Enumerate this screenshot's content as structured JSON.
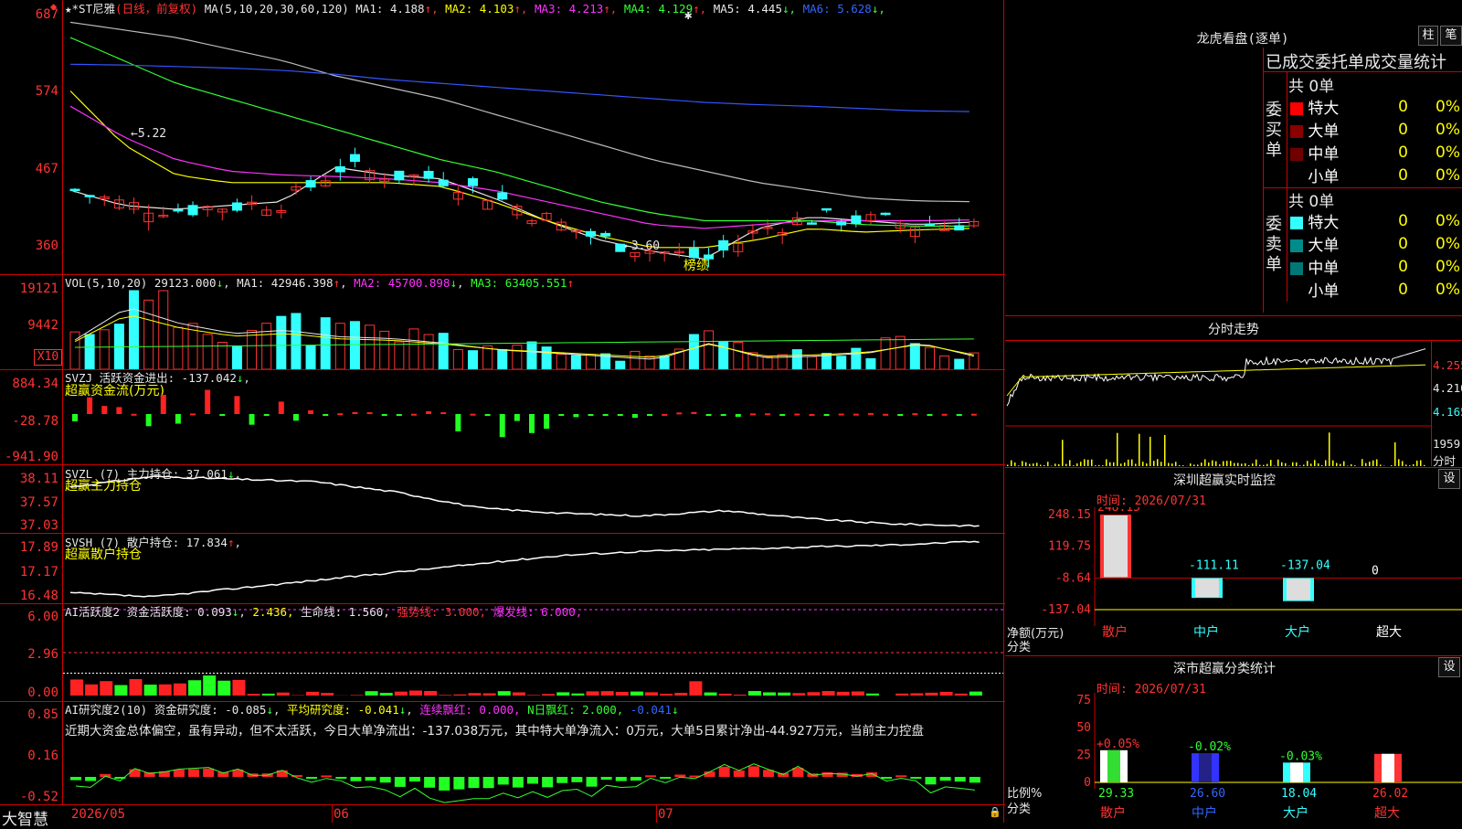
{
  "app": {
    "logo": "大智慧"
  },
  "k_header": {
    "stock": "★*ST尼雅",
    "mode": "(日线，前复权)",
    "ma_label": "MA(5,10,20,30,60,120)",
    "ma": [
      {
        "name": "MA1:",
        "value": "4.188",
        "arrow": "↑",
        "color": "#e8e8e8"
      },
      {
        "name": "MA2:",
        "value": "4.103",
        "arrow": "↑",
        "color": "#ffff00"
      },
      {
        "name": "MA3:",
        "value": "4.213",
        "arrow": "↑",
        "color": "#ff33ff"
      },
      {
        "name": "MA4:",
        "value": "4.129",
        "arrow": "↑",
        "color": "#33ff33"
      },
      {
        "name": "MA5:",
        "value": "4.445",
        "arrow": "↓",
        "color": "#e8e8e8"
      },
      {
        "name": "MA6:",
        "value": "5.628",
        "arrow": "↓",
        "color": "#3366ff"
      }
    ],
    "high_mark": "←5.22",
    "low_mark": "←3.60",
    "tag": "榜绩"
  },
  "k_axis": [
    "687",
    "574",
    "467",
    "360"
  ],
  "vol_header": {
    "label": "VOL(5,10,20)",
    "value": "29123.000",
    "arrow": "↓",
    "ma1": "MA1: 42946.398",
    "ma1_arrow": "↑",
    "ma2": "MA2: 45700.898",
    "ma2_arrow": "↓",
    "ma3": "MA3: 63405.551",
    "ma3_arrow": "↑"
  },
  "vol_axis": [
    "19121",
    "9442",
    "X10"
  ],
  "zj_header": {
    "label": "SVZJ  活跃资金进出: -137.042",
    "arrow": "↓",
    "sub": "超赢资金流(万元)"
  },
  "zj_axis": [
    "884.34",
    "-28.78",
    "-941.90"
  ],
  "zl_header": {
    "label": "SVZL (7) 主力持仓: 37.061",
    "arrow": "↓",
    "sub": "超赢主力持仓"
  },
  "zl_axis": [
    "38.11",
    "37.57",
    "37.03"
  ],
  "sh_header": {
    "label": "SVSH (7) 散户持仓: 17.834",
    "arrow": "↑",
    "sub": "超赢散户持仓"
  },
  "sh_axis": [
    "17.89",
    "17.17",
    "16.48"
  ],
  "ai_header": {
    "p1": "AI活跃度2 资金活跃度: 0.093",
    "a1": "↓",
    "p2": "2.436,",
    "p3": "生命线: 1.560,",
    "p4": "强势线: 3.000,",
    "p5": "爆发线: 6.000,"
  },
  "ai_axis": [
    "6.00",
    "2.96",
    "0.00"
  ],
  "yj_header": {
    "p1": "AI研究度2(10) 资金研究度: -0.085",
    "a1": "↓",
    "p2": "平均研究度: -0.041",
    "a2": "↓",
    "p3": "连续飘红: 0.000,",
    "p4": "N日飘红: 2.000,",
    "p5": "-0.041",
    "a5": "↓"
  },
  "yj_text": "近期大资金总体偏空，虽有异动，但不太活跃，今日大单净流出：-137.038万元，其中特大单净流入：0万元，大单5日累计净出-44.927万元，当前主力控盘",
  "yj_axis": [
    "0.85",
    "0.16",
    "-0.52"
  ],
  "x_axis": [
    "2026/05",
    "06",
    "07"
  ],
  "lhb": {
    "title": "龙虎看盘(逐单)",
    "tabs": [
      "柱",
      "笔"
    ],
    "subtitle": "已成交委托单成交量统计",
    "buy_label": "委买单",
    "sell_label": "委卖单",
    "buy_total": "共 0单",
    "sell_total": "共 0单",
    "buy": [
      {
        "name": "特大",
        "n": "0",
        "pct": "0%",
        "color": "#ff0000"
      },
      {
        "name": "大单",
        "n": "0",
        "pct": "0%",
        "color": "#8b0000"
      },
      {
        "name": "中单",
        "n": "0",
        "pct": "0%",
        "color": "#700000"
      },
      {
        "name": "小单",
        "n": "0",
        "pct": "0%",
        "color": "#000000"
      }
    ],
    "sell": [
      {
        "name": "特大",
        "n": "0",
        "pct": "0%",
        "color": "#33ffff"
      },
      {
        "name": "大单",
        "n": "0",
        "pct": "0%",
        "color": "#008b8b"
      },
      {
        "name": "中单",
        "n": "0",
        "pct": "0%",
        "color": "#007878"
      },
      {
        "name": "小单",
        "n": "0",
        "pct": "0%",
        "color": "#000000"
      }
    ]
  },
  "intraday": {
    "title": "分时走势",
    "axis": [
      "4.255",
      "4.210",
      "4.165"
    ],
    "vol_max": "1959",
    "vol_unit": "分时"
  },
  "sz_monitor": {
    "title": "深圳超赢实时监控",
    "set": "设",
    "time": "时间: 2026/07/31",
    "axis": [
      "248.15",
      "119.75",
      "-8.64",
      "-137.04"
    ],
    "unit_label": "净额(万元)",
    "cat_label": "分类",
    "cats": [
      "散户",
      "中户",
      "大户",
      "超大"
    ],
    "vals": [
      "248.15",
      "-111.11",
      "-137.04",
      "0"
    ]
  },
  "sz_class": {
    "title": "深市超赢分类统计",
    "set": "设",
    "time": "时间: 2026/07/31",
    "axis": [
      "75",
      "50",
      "25",
      "0"
    ],
    "unit_label": "比例%",
    "cat_label": "分类",
    "cats": [
      "散户",
      "中户",
      "大户",
      "超大"
    ],
    "pcts": [
      "29.33",
      "26.60",
      "18.04",
      "26.02"
    ],
    "chg": [
      "+0.05%",
      "-0.02%",
      "-0.03%",
      ""
    ]
  },
  "chart_data": [
    {
      "type": "line",
      "title": "★*ST尼雅(日线，前复权)",
      "ylim": [
        3.6,
        6.87
      ],
      "x": [
        "2026/05",
        "06",
        "07"
      ],
      "series": [
        {
          "name": "MA1",
          "values": [
            4.6,
            4.4,
            4.35,
            4.4,
            4.45,
            4.9,
            4.8,
            4.75,
            4.5,
            4.2,
            3.95,
            3.8,
            3.7,
            4.1,
            4.25,
            4.2,
            4.15,
            4.18
          ]
        },
        {
          "name": "MA2",
          "values": [
            5.9,
            5.2,
            4.8,
            4.7,
            4.7,
            4.7,
            4.7,
            4.65,
            4.45,
            4.2,
            4.0,
            3.85,
            3.85,
            3.95,
            4.1,
            4.05,
            4.08,
            4.1
          ]
        },
        {
          "name": "MA3",
          "values": [
            5.7,
            5.3,
            5.0,
            4.85,
            4.8,
            4.78,
            4.75,
            4.7,
            4.6,
            4.45,
            4.3,
            4.15,
            4.1,
            4.15,
            4.2,
            4.2,
            4.2,
            4.21
          ]
        },
        {
          "name": "MA4",
          "values": [
            6.6,
            6.3,
            6.0,
            5.8,
            5.6,
            5.4,
            5.2,
            5.0,
            4.85,
            4.65,
            4.45,
            4.3,
            4.2,
            4.2,
            4.2,
            4.15,
            4.13,
            4.13
          ]
        },
        {
          "name": "MA5",
          "values": [
            6.8,
            6.7,
            6.6,
            6.45,
            6.3,
            6.1,
            5.95,
            5.8,
            5.6,
            5.4,
            5.2,
            5.0,
            4.85,
            4.7,
            4.6,
            4.5,
            4.46,
            4.45
          ]
        },
        {
          "name": "MA6",
          "values": [
            6.25,
            6.24,
            6.22,
            6.2,
            6.17,
            6.12,
            6.05,
            6.0,
            5.95,
            5.9,
            5.85,
            5.8,
            5.75,
            5.72,
            5.7,
            5.67,
            5.64,
            5.63
          ]
        }
      ]
    },
    {
      "type": "bar",
      "title": "VOL(5,10,20)",
      "ylim": [
        0,
        19121
      ],
      "values": [
        9000,
        19121,
        14000,
        11000,
        12000,
        10000,
        9442,
        8000,
        6000,
        5000,
        4000,
        3000,
        8000,
        3500,
        4000,
        5000,
        8000,
        4000
      ]
    },
    {
      "type": "bar",
      "title": "SVZJ 活跃资金进出",
      "ylim": [
        -941.9,
        884.34
      ],
      "values": [
        700,
        880,
        550,
        -900,
        -500,
        300,
        -100,
        -137.04
      ]
    },
    {
      "type": "line",
      "title": "SVZL 主力持仓",
      "ylim": [
        37.03,
        38.11
      ],
      "values": [
        37.8,
        38.0,
        37.95,
        37.9,
        37.7,
        37.4,
        37.3,
        37.25,
        37.35,
        37.2,
        37.1,
        37.06
      ]
    },
    {
      "type": "line",
      "title": "SVSH 散户持仓",
      "ylim": [
        16.48,
        17.89
      ],
      "values": [
        16.6,
        16.5,
        16.7,
        16.9,
        17.1,
        17.3,
        17.5,
        17.6,
        17.65,
        17.7,
        17.75,
        17.83
      ]
    },
    {
      "type": "bar",
      "title": "深圳超赢实时监控",
      "categories": [
        "散户",
        "中户",
        "大户",
        "超大"
      ],
      "values": [
        248.15,
        -111.11,
        -137.04,
        0
      ]
    },
    {
      "type": "bar",
      "title": "深市超赢分类统计",
      "categories": [
        "散户",
        "中户",
        "大户",
        "超大"
      ],
      "values": [
        29.33,
        26.6,
        18.04,
        26.02
      ]
    }
  ]
}
